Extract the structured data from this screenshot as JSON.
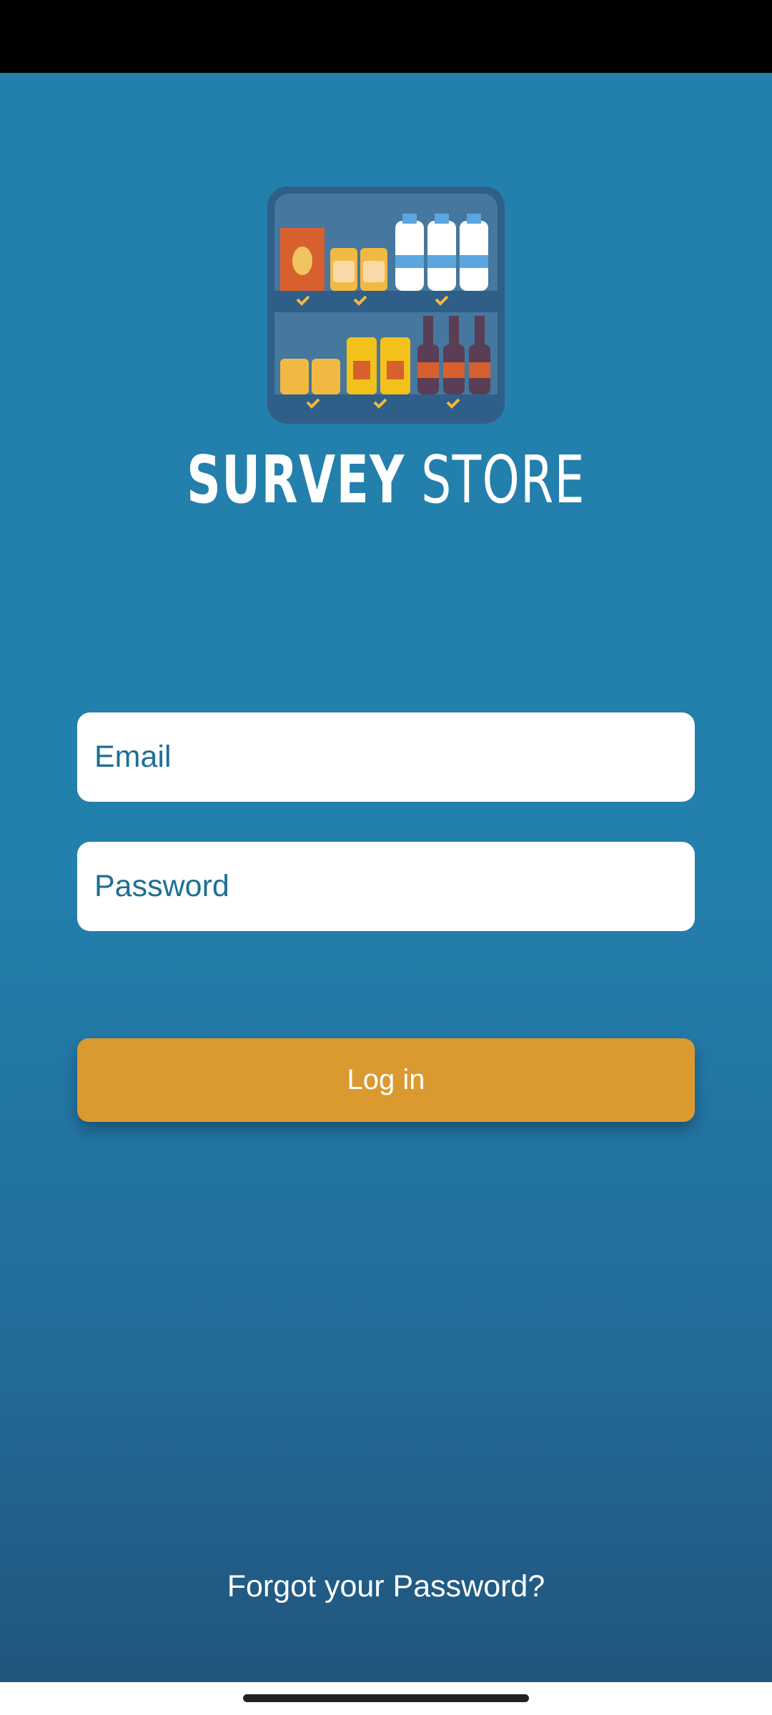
{
  "brand": {
    "bold": "SURVEY",
    "light": "STORE"
  },
  "form": {
    "email_placeholder": "Email",
    "password_placeholder": "Password",
    "login_label": "Log in",
    "forgot_label": "Forgot your Password?"
  },
  "colors": {
    "background": "#237fac",
    "background_bottom": "#21557c",
    "accent": "#db9a2f",
    "field_text": "#1e6f94"
  },
  "icons": {
    "logo": "store-shelf-icon"
  }
}
